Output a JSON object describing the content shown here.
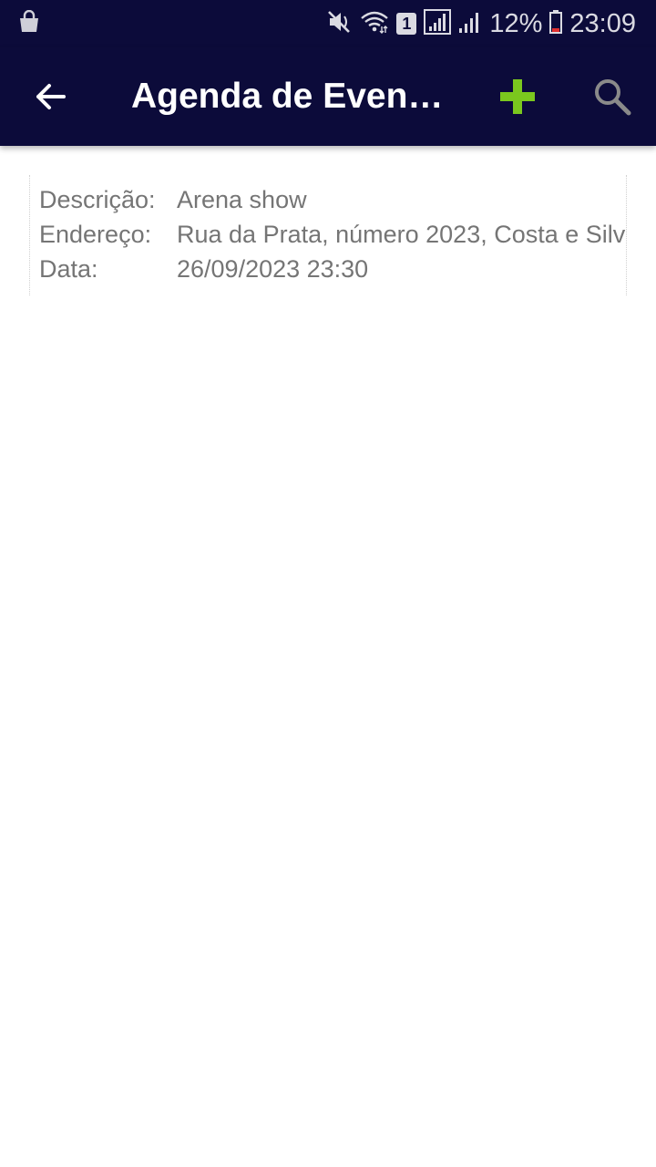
{
  "status_bar": {
    "battery": "12%",
    "time": "23:09",
    "sim_slot": "1",
    "icons": [
      "shopping-bag-icon",
      "mute-icon",
      "wifi-icon",
      "sim-icon",
      "signal-icon",
      "signal-icon",
      "battery-icon"
    ]
  },
  "app_bar": {
    "title": "Agenda de Event…",
    "icons": [
      "back-arrow-icon",
      "plus-icon",
      "search-icon"
    ],
    "colors": {
      "background": "#0c0b3a",
      "title": "#ffffff",
      "add_icon": "#7bc81e",
      "search_icon": "#8a8a8a"
    }
  },
  "event": {
    "rows": [
      {
        "label": "Descrição:",
        "value": "Arena show"
      },
      {
        "label": "Endereço:",
        "value": "Rua da Prata, número 2023, Costa e Silv"
      },
      {
        "label": "Data:",
        "value": "26/09/2023 23:30"
      }
    ]
  }
}
